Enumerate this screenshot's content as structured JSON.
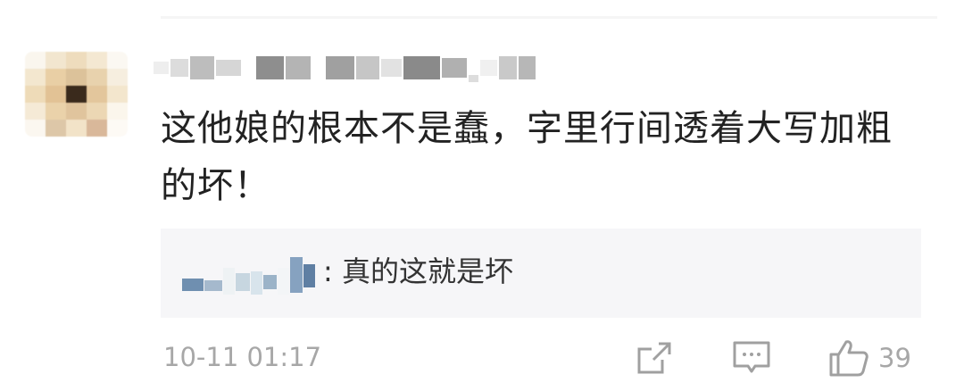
{
  "comment": {
    "text": "这他娘的根本不是蠢，字里行间透着大写加粗的坏！",
    "reply": {
      "text": ": 真的这就是坏"
    },
    "timestamp": "10-11 01:17",
    "like_count": "39",
    "actions": {
      "share_icon": "share-icon",
      "reply_icon": "comment-icon",
      "like_icon": "thumbs-up-icon"
    }
  },
  "colors": {
    "text_primary": "#222222",
    "text_meta": "#a7a7a7",
    "reply_bg": "#f6f6f8"
  }
}
